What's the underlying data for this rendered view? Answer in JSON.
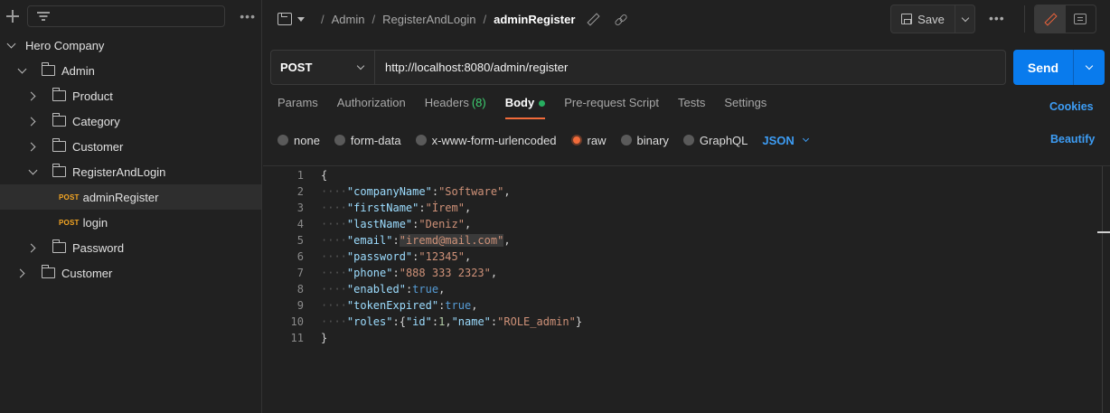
{
  "sidebar": {
    "more": "•••",
    "tree": [
      {
        "label": "Hero Company",
        "type": "workspace",
        "expanded": true,
        "level": 0
      },
      {
        "label": "Admin",
        "type": "folder",
        "expanded": true,
        "level": 1
      },
      {
        "label": "Product",
        "type": "folder",
        "expanded": false,
        "level": 2
      },
      {
        "label": "Category",
        "type": "folder",
        "expanded": false,
        "level": 2
      },
      {
        "label": "Customer",
        "type": "folder",
        "expanded": false,
        "level": 2
      },
      {
        "label": "RegisterAndLogin",
        "type": "folder",
        "expanded": true,
        "level": 2
      },
      {
        "label": "adminRegister",
        "type": "request",
        "method": "POST",
        "level": 3,
        "active": true
      },
      {
        "label": "login",
        "type": "request",
        "method": "POST",
        "level": 3
      },
      {
        "label": "Password",
        "type": "folder",
        "expanded": false,
        "level": 2
      },
      {
        "label": "Customer",
        "type": "folder",
        "expanded": false,
        "level": 1
      }
    ]
  },
  "header": {
    "breadcrumb": [
      "Admin",
      "RegisterAndLogin",
      "adminRegister"
    ],
    "save_label": "Save",
    "more": "•••"
  },
  "request": {
    "method": "POST",
    "url": "http://localhost:8080/admin/register",
    "send_label": "Send"
  },
  "tabs": [
    {
      "label": "Params"
    },
    {
      "label": "Authorization"
    },
    {
      "label": "Headers",
      "count": "(8)"
    },
    {
      "label": "Body",
      "active": true,
      "dot": true
    },
    {
      "label": "Pre-request Script"
    },
    {
      "label": "Tests"
    },
    {
      "label": "Settings"
    }
  ],
  "cookies_label": "Cookies",
  "body_types": [
    {
      "label": "none"
    },
    {
      "label": "form-data"
    },
    {
      "label": "x-www-form-urlencoded"
    },
    {
      "label": "raw",
      "selected": true
    },
    {
      "label": "binary"
    },
    {
      "label": "GraphQL"
    }
  ],
  "body_format": "JSON",
  "beautify_label": "Beautify",
  "code_lines": [
    {
      "n": "1",
      "text": "{"
    },
    {
      "n": "2",
      "key": "\"companyName\"",
      "value": "\"Software\"",
      "vtype": "string"
    },
    {
      "n": "3",
      "key": "\"firstName\"",
      "value": "\"İrem\"",
      "vtype": "string"
    },
    {
      "n": "4",
      "key": "\"lastName\"",
      "value": "\"Deniz\"",
      "vtype": "string"
    },
    {
      "n": "5",
      "key": "\"email\"",
      "value": "\"iremd@mail.com\"",
      "vtype": "string"
    },
    {
      "n": "6",
      "key": "\"password\"",
      "value": "\"12345\"",
      "vtype": "string"
    },
    {
      "n": "7",
      "key": "\"phone\"",
      "value": "\"888 333 2323\"",
      "vtype": "string"
    },
    {
      "n": "8",
      "key": "\"enabled\"",
      "value": "true",
      "vtype": "bool"
    },
    {
      "n": "9",
      "key": "\"tokenExpired\"",
      "value": "true",
      "vtype": "bool"
    },
    {
      "n": "10",
      "key": "\"roles\"",
      "value": "{\"id\":1,\"name\":\"ROLE_admin\"}",
      "vtype": "object"
    },
    {
      "n": "11",
      "text": "}"
    }
  ],
  "colors": {
    "accent_orange": "#f26b3a",
    "send_blue": "#097bed",
    "link_blue": "#3d9df5",
    "post_orange": "#f5a623",
    "success_green": "#27ae60"
  }
}
